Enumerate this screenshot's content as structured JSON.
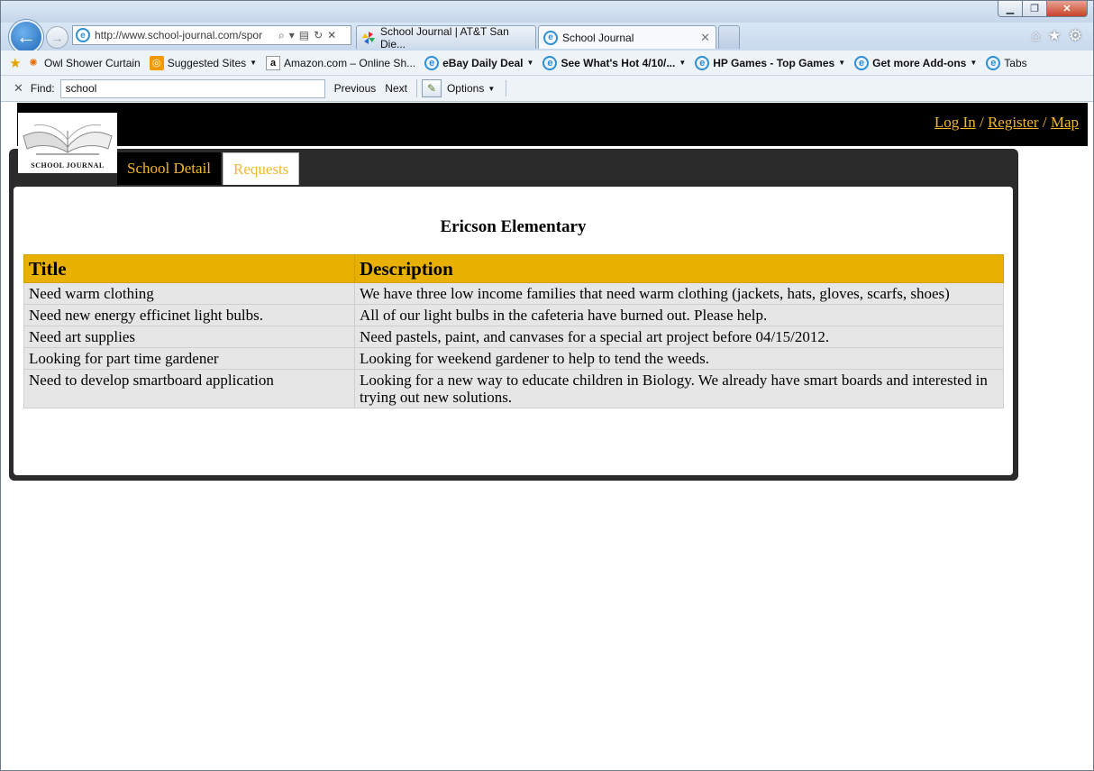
{
  "browser": {
    "address": "http://www.school-journal.com/spor",
    "tabs": [
      {
        "label": "School Journal | AT&T San Die..."
      },
      {
        "label": "School Journal"
      }
    ],
    "favorites": [
      {
        "label": "Owl Shower Curtain",
        "bold": false,
        "dropdown": false
      },
      {
        "label": "Suggested Sites",
        "bold": false,
        "dropdown": true
      },
      {
        "label": "Amazon.com – Online Sh...",
        "bold": false,
        "dropdown": false
      },
      {
        "label": "eBay Daily Deal",
        "bold": true,
        "dropdown": true
      },
      {
        "label": "See What's Hot 4/10/...",
        "bold": true,
        "dropdown": true
      },
      {
        "label": "HP Games - Top Games",
        "bold": true,
        "dropdown": true
      },
      {
        "label": "Get more Add-ons",
        "bold": true,
        "dropdown": true
      },
      {
        "label": "Tabs",
        "bold": false,
        "dropdown": false
      }
    ],
    "find": {
      "label": "Find:",
      "value": "school",
      "previous": "Previous",
      "next": "Next",
      "options": "Options"
    }
  },
  "site": {
    "logo_text": "SCHOOL JOURNAL",
    "auth": {
      "login": "Log In",
      "sep1": " / ",
      "register": "Register",
      "sep2": " / ",
      "map": "Map"
    },
    "tabs": {
      "detail": "School Detail",
      "requests": "Requests"
    },
    "school_name": "Ericson Elementary",
    "table": {
      "headers": [
        "Title",
        "Description"
      ],
      "rows": [
        [
          "Need warm clothing",
          "We have three low income families that need warm clothing (jackets, hats, gloves, scarfs, shoes)"
        ],
        [
          "Need new energy efficinet light bulbs.",
          "All of our light bulbs in the cafeteria have burned out. Please help."
        ],
        [
          "Need art supplies",
          "Need pastels, paint, and canvases for a special art project before 04/15/2012."
        ],
        [
          "Looking for part time gardener",
          "Looking for weekend gardener to help to tend the weeds."
        ],
        [
          "Need to develop smartboard application",
          "Looking for a new way to educate children in Biology. We already have smart boards and interested in trying out new solutions."
        ]
      ]
    }
  },
  "colors": {
    "accent": "#f1b82d",
    "header_bg": "#e8b000",
    "panel": "#2b2b2b"
  }
}
